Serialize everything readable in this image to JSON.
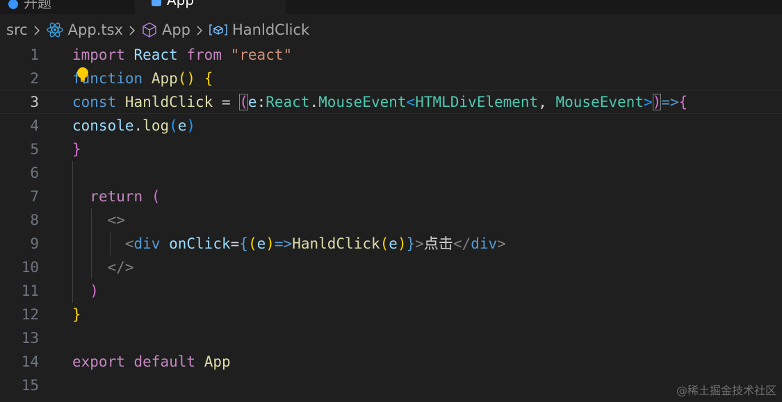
{
  "tabs": [
    {
      "label": "开题",
      "active": false
    },
    {
      "label": "App",
      "active": true
    }
  ],
  "breadcrumb": {
    "items": [
      "src",
      "App.tsx",
      "App",
      "HanldClick"
    ],
    "icons": [
      "react-icon",
      "cube-icon",
      "variable-icon"
    ]
  },
  "editor": {
    "current_line": 3,
    "line_numbers": [
      "1",
      "2",
      "3",
      "4",
      "5",
      "6",
      "7",
      "8",
      "9",
      "10",
      "11",
      "12",
      "13",
      "14",
      "15"
    ],
    "lines": [
      [
        "import",
        " ",
        "React",
        " ",
        "from",
        " ",
        "\"react\""
      ],
      [
        "function",
        " ",
        "App",
        "()",
        " ",
        "{"
      ],
      [
        "const",
        " ",
        "HanldClick",
        " = ",
        "(",
        "e",
        ":",
        "React",
        ".",
        "MouseEvent",
        "<",
        "HTMLDivElement",
        ", ",
        "MouseEvent",
        ">",
        ")",
        "=>",
        "{"
      ],
      [
        "console",
        ".",
        "log",
        "(",
        "e",
        ")"
      ],
      [
        "}"
      ],
      [],
      [
        "  ",
        "return",
        " ",
        "("
      ],
      [
        "    ",
        "<>"
      ],
      [
        "      ",
        "<",
        "div",
        " ",
        "onClick",
        "=",
        "{",
        "(",
        "e",
        ")",
        "=>",
        "HanldClick",
        "(",
        "e",
        ")",
        "}",
        ">",
        "点击",
        "</",
        "div",
        ">"
      ],
      [
        "    ",
        "</>"
      ],
      [
        "  ",
        ")"
      ],
      [
        "}"
      ],
      [],
      [
        "export",
        " ",
        "default",
        " ",
        "App"
      ],
      []
    ]
  },
  "watermark": "@稀土掘金技术社区",
  "colors": {
    "background": "#1f1f1f",
    "keyword": "#c586c0",
    "storage": "#569cd6",
    "type": "#4ec9b0",
    "function": "#dcdcaa",
    "variable": "#9cdcfe",
    "string": "#ce9178",
    "bracket1": "#ffd700",
    "bracket2": "#da70d6",
    "bracket3": "#179fff"
  }
}
